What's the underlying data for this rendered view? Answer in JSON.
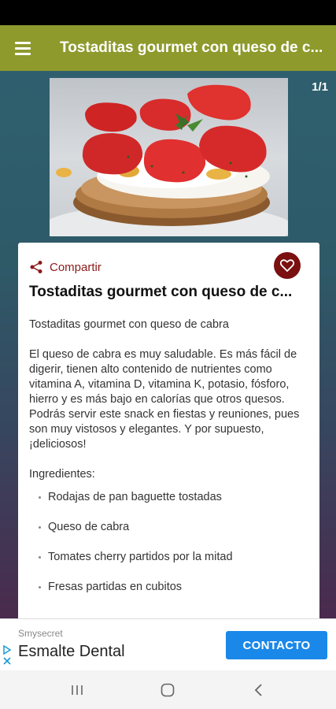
{
  "app_bar": {
    "title": "Tostaditas gourmet con queso de c...",
    "menu_icon": "hamburger-menu-icon",
    "color": "#8e9a2c"
  },
  "gallery": {
    "counter": "1/1",
    "image_alt": "Tostadita con queso de cabra, fresas y miel"
  },
  "recipe": {
    "share_label": "Compartir",
    "share_icon": "share-icon",
    "favorite_icon": "heart-icon",
    "title": "Tostaditas gourmet con queso de c...",
    "subtitle": "Tostaditas gourmet con queso de cabra",
    "description": "El queso de cabra es muy saludable. Es más fácil de digerir, tienen alto contenido de nutrientes como vitamina A, vitamina D, vitamina K, potasio, fósforo, hierro y es más bajo en calorías que otros quesos. Podrás servir este snack en fiestas y reuniones, pues son muy vistosos y elegantes. Y por supuesto, ¡deliciosos!",
    "ingredients_label": "Ingredientes:",
    "ingredients": [
      "Rodajas de pan baguette tostadas",
      "Queso de cabra",
      "Tomates cherry partidos por la mitad",
      "Fresas partidas en cubitos"
    ],
    "accent_color": "#8b1a1a"
  },
  "ad": {
    "source": "Smysecret",
    "name": "Esmalte Dental",
    "cta": "CONTACTO",
    "cta_color": "#1a88e8"
  },
  "nav": {
    "recents_icon": "recents-icon",
    "home_icon": "home-icon",
    "back_icon": "back-icon"
  }
}
